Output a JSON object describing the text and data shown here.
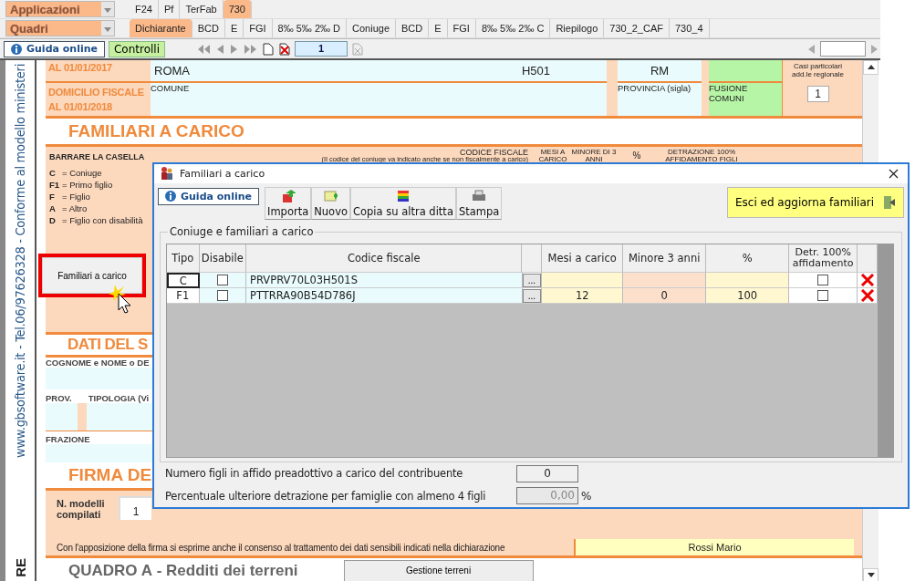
{
  "app_menu": {
    "applications": "Applicazioni",
    "sheets": "Quadri"
  },
  "module_tabs": [
    {
      "label": "F24",
      "selected": false
    },
    {
      "label": "Pf",
      "selected": false
    },
    {
      "label": "TerFab",
      "selected": false
    },
    {
      "label": "730",
      "selected": true
    }
  ],
  "section_tabs": [
    {
      "label": "Dichiarante",
      "selected": true
    },
    {
      "label": "BCD",
      "selected": false
    },
    {
      "label": "E",
      "selected": false
    },
    {
      "label": "FGI",
      "selected": false
    },
    {
      "label": "8‰  5‰ 2‰ D",
      "selected": false
    },
    {
      "label": "Coniuge",
      "selected": false
    },
    {
      "label": "BCD",
      "selected": false
    },
    {
      "label": "E",
      "selected": false
    },
    {
      "label": "FGI",
      "selected": false
    },
    {
      "label": "8‰  5‰ 2‰ C",
      "selected": false
    },
    {
      "label": "Riepilogo",
      "selected": false
    },
    {
      "label": "730_2_CAF",
      "selected": false
    },
    {
      "label": "730_4",
      "selected": false
    }
  ],
  "toolbar": {
    "help": "Guida online",
    "checks": "Controlli",
    "page": "1"
  },
  "side_text": "www.gbsoftware.it - Tel.06/97626328 - Conforme al modello ministeri",
  "side_mark": "RE",
  "residence": {
    "label_2017": "AL 01/01/2017",
    "city": "ROMA",
    "city_code": "H501",
    "province": "RM",
    "label_2018_1": "DOMICILIO FISCALE",
    "label_2018_2": "AL 01/01/2018",
    "city_label": "COMUNE",
    "province_label": "PROVINCIA (sigla)",
    "merger_label": "FUSIONE COMUNI",
    "special_label": "Casi particolari add.le regionale",
    "special_value": "1"
  },
  "dependents_section": {
    "title": "FAMILIARI A CARICO",
    "legend_title": "BARRARE LA CASELLA",
    "legend": [
      {
        "code": "C",
        "text": "= Coniuge"
      },
      {
        "code": "F1",
        "text": "= Primo figlio"
      },
      {
        "code": "F",
        "text": "= Figlio"
      },
      {
        "code": "A",
        "text": "= Altro"
      },
      {
        "code": "D",
        "text": "= Figlio con disabilità"
      }
    ],
    "headers": {
      "tax_code": "CODICE FISCALE",
      "tax_code_note": "(Il codice del coniuge va indicato anche se non fiscalmente a carico)",
      "months": "MESI A CARICO",
      "under3": "MINORE DI 3 ANNI",
      "percent": "%",
      "deduction": "DETRAZIONE 100% AFFIDAMENTO FIGLI"
    },
    "button": "Familiari a carico"
  },
  "taxpayer_section": {
    "title": "DATI DEL S",
    "name_label": "COGNOME e NOME o DE",
    "prov_label": "PROV.",
    "type_label": "TIPOLOGIA (Vi",
    "hamlet_label": "FRAZIONE"
  },
  "signature_section": {
    "title": "FIRMA DE",
    "models_label": "N. modelli compilati",
    "models_value": "1",
    "consent": "Con l'apposizione della firma si esprime anche il consenso al trattamento dei dati sensibili indicati nella dichiarazione",
    "signer": "Rossi Mario"
  },
  "next_section": {
    "title": "**QUADRO A** - Redditi dei terreni",
    "button": "Gestione terreni"
  },
  "dialog": {
    "title": "Familiari a carico",
    "help": "Guida online",
    "actions": [
      {
        "kind": "import",
        "label": "Importa"
      },
      {
        "kind": "new",
        "label": "Nuovo"
      },
      {
        "kind": "copy",
        "label": "Copia su altra ditta"
      },
      {
        "kind": "print",
        "label": "Stampa"
      }
    ],
    "exit": "Esci ed aggiorna familiari",
    "lookup": "...",
    "group": "Coniuge e familiari a carico",
    "columns": [
      "Tipo",
      "Disabile",
      "Codice fiscale",
      "Mesi a carico",
      "Minore 3 anni",
      "%",
      "Detr. 100% affidamento"
    ],
    "rows": [
      {
        "type": "C",
        "disabled_person": false,
        "tax_code": "PRVPRV70L03H501S",
        "months": "",
        "under3": "",
        "percent": "",
        "deduction": false,
        "selected": true
      },
      {
        "type": "F1",
        "disabled_person": false,
        "tax_code": "PTTRRA90B54D786J",
        "months": "12",
        "under3": "0",
        "percent": "100",
        "deduction": false,
        "selected": false
      }
    ],
    "foster_label": "Numero figli in affido preadottivo a carico del contribuente",
    "foster_value": "0",
    "extra_label": "Percentuale ulteriore detrazione per famiglie con almeno 4 figli",
    "extra_value": "0,00",
    "extra_disabled": true,
    "extra_unit": "%"
  }
}
